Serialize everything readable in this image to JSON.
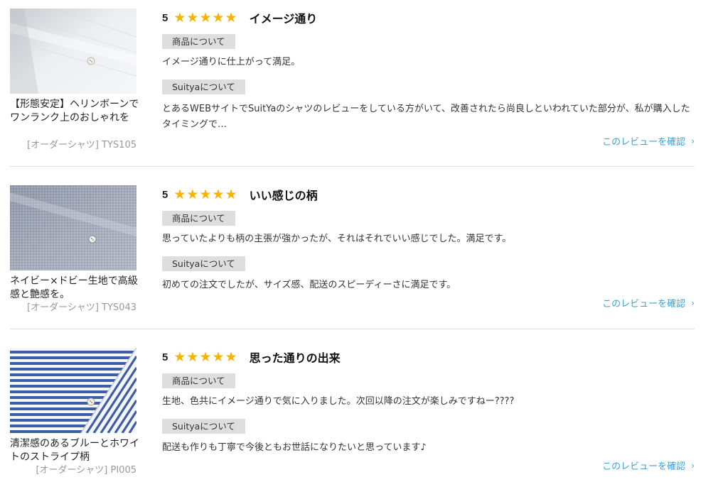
{
  "link_label": "このレビューを確認",
  "reviews": [
    {
      "product_name": "【形態安定】ヘリンボーンでワンランク上のおしゃれを",
      "product_code": "[オーダーシャツ] TYS105",
      "score": "5",
      "stars": 5,
      "title": "イメージ通り",
      "tag_product": "商品について",
      "product_comment": "イメージ通りに仕上がって満足。",
      "tag_shop": "Suityaについて",
      "shop_comment": "とあるWEBサイトでSuitYaのシャツのレビューをしている方がいて、改善されたら尚良しといわれていた部分が、私が購入したタイミングで…"
    },
    {
      "product_name": "ネイビー×ドビー生地で高級感と艶感を。",
      "product_code": "[オーダーシャツ] TYS043",
      "score": "5",
      "stars": 5,
      "title": "いい感じの柄",
      "tag_product": "商品について",
      "product_comment": "思っていたよりも柄の主張が強かったが、それはそれでいい感じでした。満足です。",
      "tag_shop": "Suityaについて",
      "shop_comment": "初めての注文でしたが、サイズ感、配送のスピーディーさに満足です。"
    },
    {
      "product_name": "清潔感のあるブルーとホワイトのストライプ柄",
      "product_code": "[オーダーシャツ] PI005",
      "score": "5",
      "stars": 5,
      "title": "思った通りの出来",
      "tag_product": "商品について",
      "product_comment": "生地、色共にイメージ通りで気に入りました。次回以降の注文が楽しみですねー????",
      "tag_shop": "Suityaについて",
      "shop_comment": "配送も作りも丁寧で今後ともお世話になりたいと思っています♪"
    }
  ],
  "colors": {
    "star": "#f6b400",
    "link": "#3aa2d6",
    "tag_bg": "#dedede"
  }
}
